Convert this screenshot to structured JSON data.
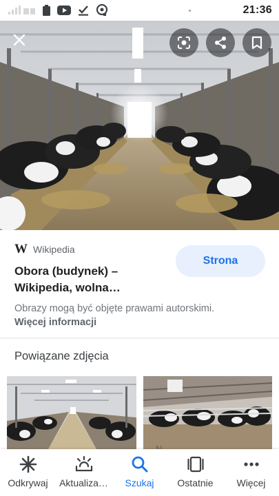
{
  "status_bar": {
    "time": "21:36",
    "icons": [
      "signal-icon",
      "battery-icon",
      "youtube-icon",
      "download-done-icon",
      "lens-icon"
    ]
  },
  "hero": {
    "actions": [
      "close-icon",
      "lens-search-icon",
      "share-icon",
      "bookmark-icon"
    ]
  },
  "result": {
    "source_logo": "W",
    "source_name": "Wikipedia",
    "title": "Obora (budynek) – Wikipedia, wolna…",
    "page_button_label": "Strona",
    "rights_text": "Obrazy mogą być objęte prawami autorskimi.",
    "rights_link": "Więcej informacji"
  },
  "related": {
    "title": "Powiązane zdjęcia",
    "caption_fragment": "N"
  },
  "bottom_nav": {
    "items": [
      {
        "label": "Odkrywaj",
        "icon": "asterisk-icon"
      },
      {
        "label": "Aktualiza…",
        "icon": "updates-icon"
      },
      {
        "label": "Szukaj",
        "icon": "search-icon"
      },
      {
        "label": "Ostatnie",
        "icon": "tabs-icon"
      },
      {
        "label": "Więcej",
        "icon": "more-icon"
      }
    ],
    "active_index": 2
  },
  "colors": {
    "accent": "#1a73e8",
    "button_bg": "#e8f0fe",
    "text_primary": "#202124",
    "text_secondary": "#70757a"
  }
}
